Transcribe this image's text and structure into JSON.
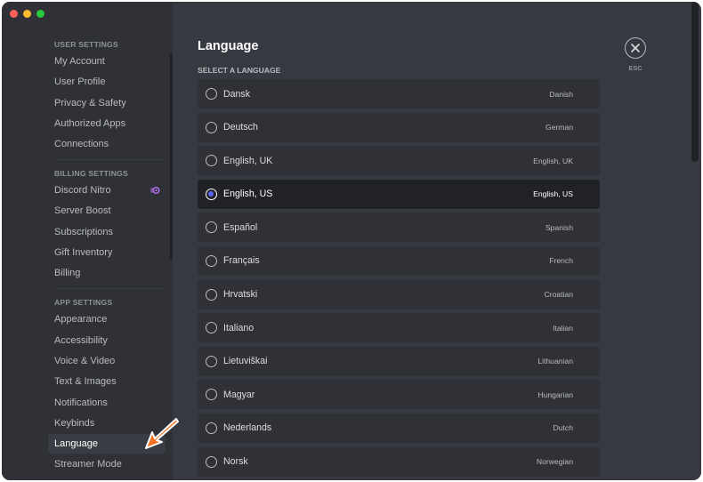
{
  "colors": {
    "sidebar_bg": "#2f3136",
    "content_bg": "#36393f",
    "row_bg": "#2f3136",
    "selected_row_bg": "#202225",
    "radio_accent": "#5865f2",
    "annotation_arrow": "#f37021"
  },
  "window": {
    "controls": [
      "close",
      "minimize",
      "zoom"
    ]
  },
  "sidebar": {
    "sections": [
      {
        "header": "USER SETTINGS",
        "items": [
          {
            "label": "My Account"
          },
          {
            "label": "User Profile"
          },
          {
            "label": "Privacy & Safety"
          },
          {
            "label": "Authorized Apps"
          },
          {
            "label": "Connections"
          }
        ]
      },
      {
        "header": "BILLING SETTINGS",
        "items": [
          {
            "label": "Discord Nitro",
            "icon": "nitro-icon"
          },
          {
            "label": "Server Boost"
          },
          {
            "label": "Subscriptions"
          },
          {
            "label": "Gift Inventory"
          },
          {
            "label": "Billing"
          }
        ]
      },
      {
        "header": "APP SETTINGS",
        "items": [
          {
            "label": "Appearance"
          },
          {
            "label": "Accessibility"
          },
          {
            "label": "Voice & Video"
          },
          {
            "label": "Text & Images"
          },
          {
            "label": "Notifications"
          },
          {
            "label": "Keybinds"
          },
          {
            "label": "Language",
            "active": true
          },
          {
            "label": "Streamer Mode"
          }
        ]
      }
    ]
  },
  "main": {
    "title": "Language",
    "select_label": "SELECT A LANGUAGE",
    "close_label": "ESC",
    "languages": [
      {
        "name": "Dansk",
        "native": "Danish"
      },
      {
        "name": "Deutsch",
        "native": "German"
      },
      {
        "name": "English, UK",
        "native": "English, UK"
      },
      {
        "name": "English, US",
        "native": "English, US",
        "selected": true
      },
      {
        "name": "Español",
        "native": "Spanish"
      },
      {
        "name": "Français",
        "native": "French"
      },
      {
        "name": "Hrvatski",
        "native": "Croatian"
      },
      {
        "name": "Italiano",
        "native": "Italian"
      },
      {
        "name": "Lietuviškai",
        "native": "Lithuanian"
      },
      {
        "name": "Magyar",
        "native": "Hungarian"
      },
      {
        "name": "Nederlands",
        "native": "Dutch"
      },
      {
        "name": "Norsk",
        "native": "Norwegian"
      }
    ]
  }
}
